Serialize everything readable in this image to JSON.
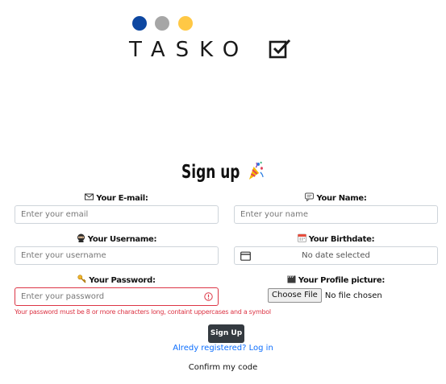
{
  "brand": {
    "name": "TASKO",
    "dot_colors": [
      "#0d47a1",
      "#a6a6a6",
      "#ffc845"
    ]
  },
  "form": {
    "title": "Sign up",
    "fields": {
      "email": {
        "label": "Your E-mail:",
        "icon": "envelope-icon",
        "placeholder": "Enter your email"
      },
      "name": {
        "label": "Your Name:",
        "icon": "speech-bubble-icon",
        "placeholder": "Enter your name"
      },
      "username": {
        "label": "Your Username:",
        "icon": "ninja-icon",
        "placeholder": "Enter your username"
      },
      "birthdate": {
        "label": "Your Birthdate:",
        "icon": "calendar-icon",
        "value": "No date selected"
      },
      "password": {
        "label": "Your Password:",
        "icon": "key-icon",
        "placeholder": "Enter your password",
        "error": "Your password must be 8 or more characters long, containt uppercases and a symbol"
      },
      "picture": {
        "label": "Your Profile picture:",
        "icon": "clapper-icon",
        "button": "Choose File",
        "status": "No file chosen"
      }
    },
    "submit_label": "Sign Up",
    "login_link": "Alredy registered? Log in",
    "confirm_link": "Confirm my code"
  },
  "colors": {
    "error": "#dc3545",
    "link": "#0d6efd",
    "button": "#343a40"
  }
}
